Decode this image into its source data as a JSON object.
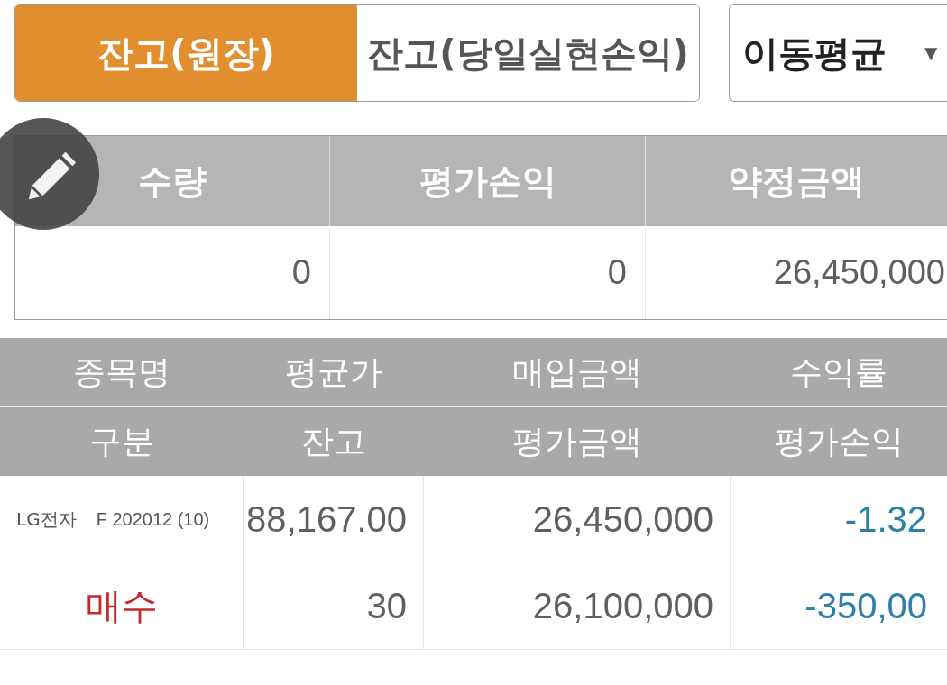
{
  "tabs": [
    {
      "label": "잔고(원장)",
      "selected": true
    },
    {
      "label": "잔고(당일실현손익)",
      "selected": false
    }
  ],
  "dropdown": {
    "value": "이동평균",
    "caret": "▼"
  },
  "summary": {
    "columns": [
      "수량",
      "평가손익",
      "약정금액"
    ],
    "values": [
      "0",
      "0",
      "26,450,000"
    ]
  },
  "holdings": {
    "header_rows": [
      [
        "종목명",
        "평균가",
        "매입금액",
        "수익률"
      ],
      [
        "구분",
        "잔고",
        "평가금액",
        "평가손익"
      ]
    ],
    "rows": [
      {
        "name": "LG전자",
        "code": "F 202012 (10)",
        "side": {
          "text": "매수",
          "color": "#c62828"
        },
        "average_price": "88,167.00",
        "quantity": "30",
        "purchase_amount": "26,450,000",
        "valuation_amount": "26,100,000",
        "return_rate": {
          "text": "-1.32",
          "color": "#2f80a8"
        },
        "profit_loss": {
          "text": "-350,00",
          "color": "#2f80a8"
        }
      }
    ]
  }
}
